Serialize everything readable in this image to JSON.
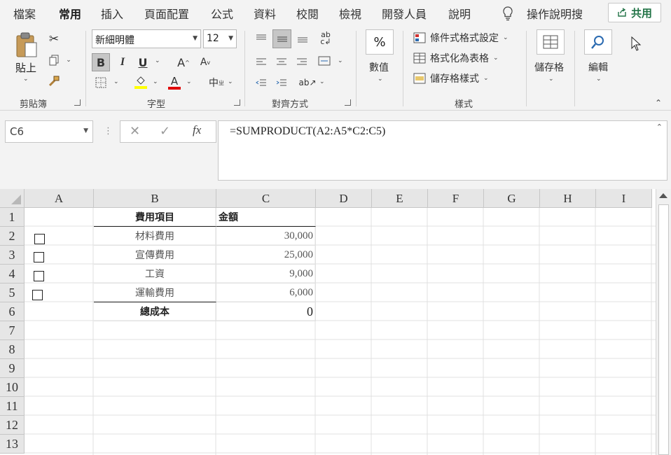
{
  "ribbon_tabs": [
    "檔案",
    "常用",
    "插入",
    "頁面配置",
    "公式",
    "資料",
    "校閱",
    "檢視",
    "開發人員",
    "說明"
  ],
  "active_tab": "常用",
  "tell_me": "操作說明搜",
  "share_label": "共用",
  "clipboard": {
    "paste_label": "貼上",
    "group_label": "剪貼簿"
  },
  "font": {
    "name": "新細明體",
    "size": "12",
    "group_label": "字型",
    "bold": "B",
    "italic": "I",
    "underline": "U",
    "grow": "A",
    "shrink": "A",
    "font_color_letter": "A",
    "phonetic": "中"
  },
  "alignment": {
    "group_label": "對齊方式"
  },
  "number": {
    "label": "數值",
    "symbol": "%"
  },
  "styles": {
    "cond_format": "條件式格式設定",
    "format_table": "格式化為表格",
    "cell_styles": "儲存格樣式",
    "group_label": "樣式"
  },
  "cells": {
    "label": "儲存格"
  },
  "editing": {
    "label": "編輯"
  },
  "formula_bar": {
    "name_box": "C6",
    "formula": "=SUMPRODUCT(A2:A5*C2:C5)",
    "fx": "fx"
  },
  "colors": {
    "accent": "#217346",
    "font_color_bar": "#e00000",
    "highlight_bar": "#ffff00"
  },
  "columns": [
    "A",
    "B",
    "C",
    "D",
    "E",
    "F",
    "G",
    "H",
    "I"
  ],
  "rows": [
    "1",
    "2",
    "3",
    "4",
    "5",
    "6",
    "7",
    "8",
    "9",
    "10",
    "11",
    "12",
    "13"
  ],
  "sheet": {
    "header": {
      "item": "費用項目",
      "amount": "金額"
    },
    "items": [
      {
        "name": "材料費用",
        "amount": "30,000"
      },
      {
        "name": "宣傳費用",
        "amount": "25,000"
      },
      {
        "name": "工資",
        "amount": "9,000"
      },
      {
        "name": "運輸費用",
        "amount": "6,000"
      }
    ],
    "total": {
      "label": "總成本",
      "value": "0"
    }
  }
}
